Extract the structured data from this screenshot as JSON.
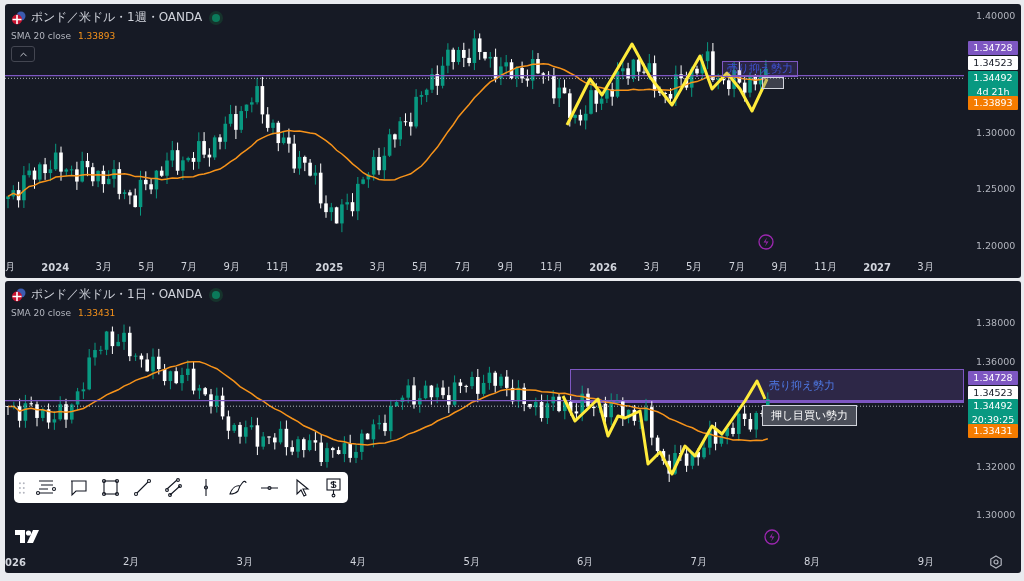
{
  "panels": [
    {
      "title": "ポンド／米ドル・1週・OANDA",
      "live": true,
      "indicator": {
        "name": "SMA 20 close",
        "value": "1.33893"
      },
      "collapse_button": true,
      "price_ticks": [
        "1.40000",
        "1.30000",
        "1.25000",
        "1.20000"
      ],
      "price_tags": [
        {
          "text": "1.34728",
          "color": "#7e57c2"
        },
        {
          "text": "1.34523",
          "color": "#ffffff"
        },
        {
          "text": "1.34492",
          "time": "4d 21h",
          "color": "#089981"
        },
        {
          "text": "1.33893",
          "color": "#f57c00"
        }
      ],
      "annotations": [
        {
          "kind": "label",
          "text": "売り抑え勢力"
        },
        {
          "kind": "box"
        }
      ],
      "time_labels": [
        {
          "text": "月",
          "bold": false
        },
        {
          "text": "2024",
          "bold": true
        },
        {
          "text": "3月",
          "bold": false
        },
        {
          "text": "5月",
          "bold": false
        },
        {
          "text": "7月",
          "bold": false
        },
        {
          "text": "9月",
          "bold": false
        },
        {
          "text": "11月",
          "bold": false
        },
        {
          "text": "2025",
          "bold": true
        },
        {
          "text": "3月",
          "bold": false
        },
        {
          "text": "5月",
          "bold": false
        },
        {
          "text": "7月",
          "bold": false
        },
        {
          "text": "9月",
          "bold": false
        },
        {
          "text": "11月",
          "bold": false
        },
        {
          "text": "2026",
          "bold": true
        },
        {
          "text": "3月",
          "bold": false
        },
        {
          "text": "5月",
          "bold": false
        },
        {
          "text": "7月",
          "bold": false
        },
        {
          "text": "9月",
          "bold": false
        },
        {
          "text": "11月",
          "bold": false
        },
        {
          "text": "2027",
          "bold": true
        },
        {
          "text": "3月",
          "bold": false
        }
      ]
    },
    {
      "title": "ポンド／米ドル・1日・OANDA",
      "live": true,
      "indicator": {
        "name": "SMA 20 close",
        "value": "1.33431"
      },
      "collapse_button": false,
      "price_ticks": [
        "1.38000",
        "1.36000",
        "1.32000",
        "1.30000"
      ],
      "price_tags": [
        {
          "text": "1.34728",
          "color": "#7e57c2"
        },
        {
          "text": "1.34523",
          "color": "#ffffff"
        },
        {
          "text": "1.34492",
          "time": "20:39:25",
          "color": "#089981"
        },
        {
          "text": "1.33431",
          "color": "#f57c00"
        }
      ],
      "annotations": [
        {
          "kind": "zone",
          "text": "売り抑え勢力"
        },
        {
          "kind": "callout",
          "text": "押し目買い勢力"
        }
      ],
      "time_labels": [
        {
          "text": "026",
          "bold": true
        },
        {
          "text": "2月",
          "bold": false
        },
        {
          "text": "3月",
          "bold": false
        },
        {
          "text": "4月",
          "bold": false
        },
        {
          "text": "5月",
          "bold": false
        },
        {
          "text": "6月",
          "bold": false
        },
        {
          "text": "7月",
          "bold": false
        },
        {
          "text": "8月",
          "bold": false
        },
        {
          "text": "9月",
          "bold": false
        }
      ]
    }
  ]
}
